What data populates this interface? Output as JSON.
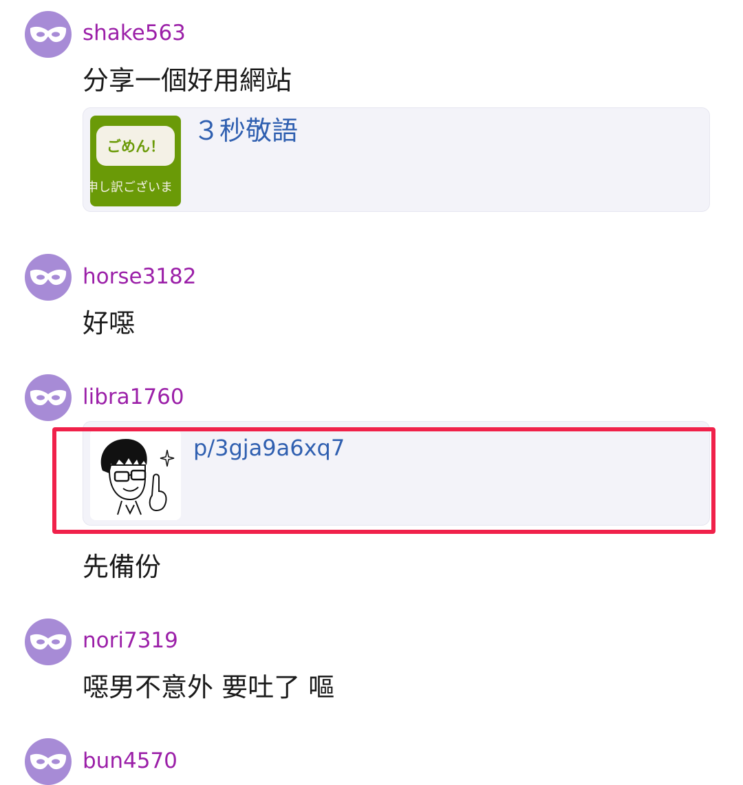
{
  "comments": [
    {
      "username": "shake563",
      "text": "分享一個好用網站",
      "card": {
        "title": "３秒敬語",
        "thumb_button": "ごめん！",
        "thumb_caption": "申し訳ございま"
      }
    },
    {
      "username": "horse3182",
      "text": "好噁"
    },
    {
      "username": "libra1760",
      "card": {
        "title": "p/3gja9a6xq7"
      },
      "text": "先備份"
    },
    {
      "username": "nori7319",
      "text": "噁男不意外 要吐了 嘔"
    },
    {
      "username": "bun4570"
    }
  ],
  "colors": {
    "avatar": "#a78bd6",
    "username": "#9b1fa8",
    "link": "#2f5fb0",
    "card_background": "#f3f3f9",
    "highlight": "#f0214a",
    "thumb_green": "#6a9a07"
  },
  "icons": {
    "avatar": "anonymous-mask-icon"
  }
}
